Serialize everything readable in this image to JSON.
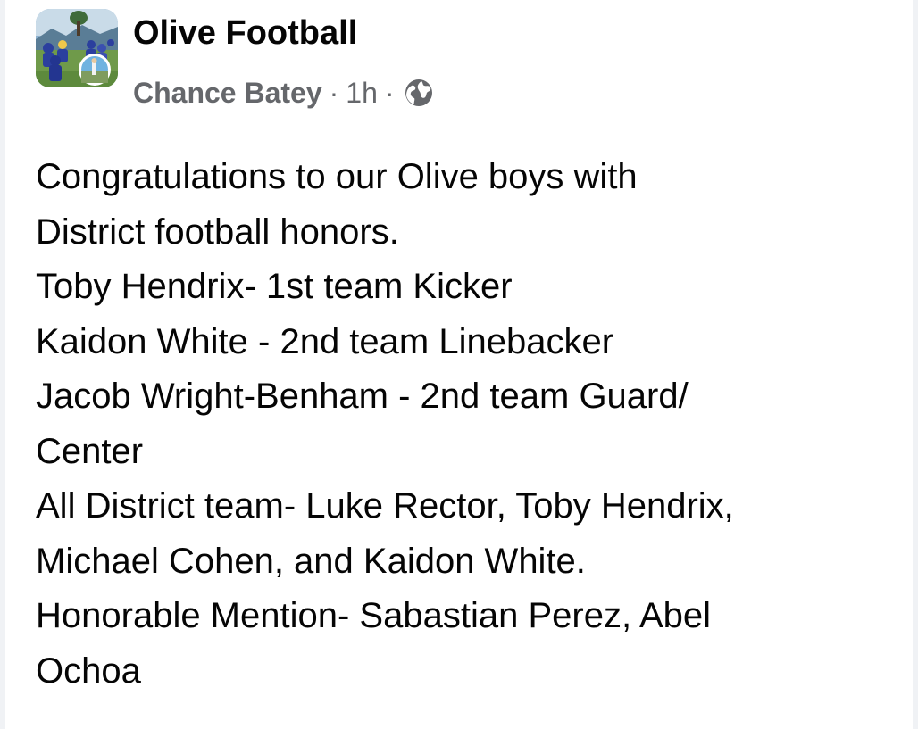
{
  "post": {
    "page_name": "Olive Football",
    "author": "Chance Batey",
    "separator": "·",
    "time": "1h",
    "privacy_icon": "globe-icon",
    "avatar_icon": "football-team-photo",
    "lines": [
      "Congratulations to our Olive boys with",
      "District football honors.",
      "Toby Hendrix- 1st team Kicker",
      "Kaidon White - 2nd team Linebacker",
      "Jacob Wright-Benham - 2nd team Guard/",
      "Center",
      "All District team- Luke Rector, Toby Hendrix,",
      "Michael Cohen, and Kaidon White.",
      "Honorable Mention- Sabastian Perez, Abel",
      "Ochoa"
    ]
  },
  "colors": {
    "text_primary": "#050505",
    "text_secondary": "#65676b",
    "background": "#ffffff",
    "edge": "#f0f2f5"
  }
}
